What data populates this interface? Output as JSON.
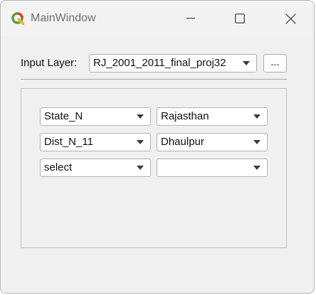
{
  "window": {
    "title": "MainWindow",
    "icon": "qgis-logo-icon",
    "controls": [
      "minimize-icon",
      "maximize-icon",
      "close-icon"
    ]
  },
  "layer_row": {
    "label": "Input Layer:",
    "selected_layer": "RJ_2001_2011_final_proj32",
    "browse_label": "..."
  },
  "filters": [
    {
      "field": "State_N",
      "value": "Rajasthan"
    },
    {
      "field": "Dist_N_11",
      "value": "Dhaulpur"
    },
    {
      "field": "select",
      "value": ""
    }
  ],
  "colors": {
    "window_bg": "#f0f0f0",
    "qgis_green": "#5aa12f",
    "qgis_red": "#e23b2e",
    "qgis_yellow": "#f3b230"
  }
}
